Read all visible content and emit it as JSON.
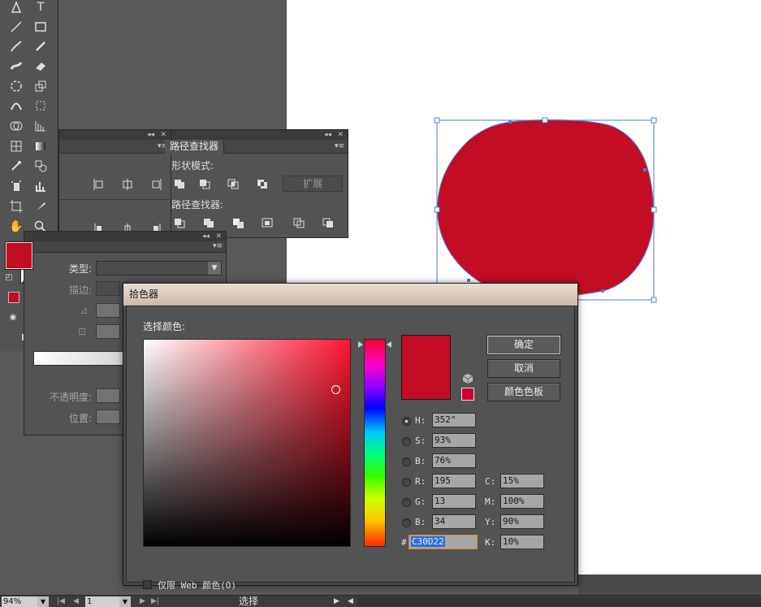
{
  "colors": {
    "fill": "#c30d22",
    "dialog_title_bg": "#d9c9bb",
    "artboard": "#ffffff"
  },
  "tools": [
    "pen-tool-icon",
    "type-tool-icon",
    "line-tool-icon",
    "rectangle-tool-icon",
    "paintbrush-tool-icon",
    "pencil-tool-icon",
    "blob-brush-tool-icon",
    "eraser-tool-icon",
    "rotate-tool-icon",
    "scale-tool-icon",
    "width-tool-icon",
    "free-transform-tool-icon",
    "shape-builder-tool-icon",
    "perspective-grid-tool-icon",
    "mesh-tool-icon",
    "gradient-tool-icon",
    "eyedropper-tool-icon",
    "blend-tool-icon",
    "symbol-sprayer-tool-icon",
    "column-graph-tool-icon",
    "artboard-tool-icon",
    "slice-tool-icon",
    "hand-tool-icon",
    "zoom-tool-icon"
  ],
  "pathfinder_panel": {
    "tab": "路径查找器",
    "shape_modes_label": "形状模式:",
    "expand_label": "扩展",
    "pathfinders_label": "路径查找器:"
  },
  "gradient_panel": {
    "type_label": "类型:",
    "stroke_label": "描边:",
    "opacity_label": "不透明度:",
    "position_label": "位置:"
  },
  "color_picker": {
    "title": "拾色器",
    "select_color_label": "选择颜色:",
    "buttons": {
      "ok": "确定",
      "cancel": "取消",
      "swatches": "颜色色板"
    },
    "hsb": [
      {
        "label": "H:",
        "value": "352°"
      },
      {
        "label": "S:",
        "value": "93%"
      },
      {
        "label": "B:",
        "value": "76%"
      }
    ],
    "rgb": [
      {
        "label": "R:",
        "value": "195"
      },
      {
        "label": "G:",
        "value": "13"
      },
      {
        "label": "B:",
        "value": "34"
      }
    ],
    "cmyk": [
      {
        "label": "C:",
        "value": "15%"
      },
      {
        "label": "M:",
        "value": "100%"
      },
      {
        "label": "Y:",
        "value": "90%"
      },
      {
        "label": "K:",
        "value": "10%"
      }
    ],
    "hex_label": "#",
    "hex_value": "C30D22",
    "web_only_label": "仅限 Web 颜色(O)"
  },
  "statusbar": {
    "zoom": "94%",
    "artboard_number": "1",
    "status_text": "选择"
  }
}
